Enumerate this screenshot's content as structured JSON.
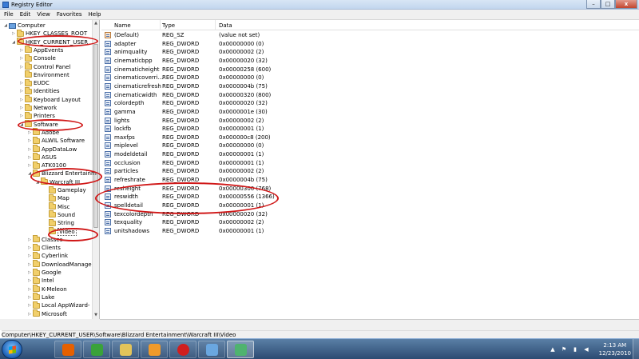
{
  "window": {
    "title": "Registry Editor",
    "btn_min": "–",
    "btn_max": "□",
    "btn_close": "x"
  },
  "menu": [
    "File",
    "Edit",
    "View",
    "Favorites",
    "Help"
  ],
  "tree": [
    {
      "label": "Computer",
      "indent": 0,
      "icon": "computer",
      "exp": "◢"
    },
    {
      "label": "HKEY_CLASSES_ROOT",
      "indent": 1,
      "icon": "folder",
      "exp": "▷"
    },
    {
      "label": "HKEY_CURRENT_USER",
      "indent": 1,
      "icon": "folder",
      "exp": "◢"
    },
    {
      "label": "AppEvents",
      "indent": 2,
      "icon": "folder",
      "exp": "▷"
    },
    {
      "label": "Console",
      "indent": 2,
      "icon": "folder",
      "exp": "▷"
    },
    {
      "label": "Control Panel",
      "indent": 2,
      "icon": "folder",
      "exp": "▷"
    },
    {
      "label": "Environment",
      "indent": 2,
      "icon": "folder",
      "exp": ""
    },
    {
      "label": "EUDC",
      "indent": 2,
      "icon": "folder",
      "exp": "▷"
    },
    {
      "label": "Identities",
      "indent": 2,
      "icon": "folder",
      "exp": "▷"
    },
    {
      "label": "Keyboard Layout",
      "indent": 2,
      "icon": "folder",
      "exp": "▷"
    },
    {
      "label": "Network",
      "indent": 2,
      "icon": "folder",
      "exp": "▷"
    },
    {
      "label": "Printers",
      "indent": 2,
      "icon": "folder",
      "exp": "▷"
    },
    {
      "label": "Software",
      "indent": 2,
      "icon": "folder",
      "exp": "◢"
    },
    {
      "label": "Adobe",
      "indent": 3,
      "icon": "folder",
      "exp": "▷"
    },
    {
      "label": "ALWIL Software",
      "indent": 3,
      "icon": "folder",
      "exp": "▷"
    },
    {
      "label": "AppDataLow",
      "indent": 3,
      "icon": "folder",
      "exp": "▷"
    },
    {
      "label": "ASUS",
      "indent": 3,
      "icon": "folder",
      "exp": "▷"
    },
    {
      "label": "ATK0100",
      "indent": 3,
      "icon": "folder",
      "exp": "▷"
    },
    {
      "label": "Blizzard Entertainm",
      "indent": 3,
      "icon": "folder",
      "exp": "◢"
    },
    {
      "label": "Warcraft III",
      "indent": 4,
      "icon": "folder",
      "exp": "◢"
    },
    {
      "label": "Gameplay",
      "indent": 5,
      "icon": "folder",
      "exp": ""
    },
    {
      "label": "Map",
      "indent": 5,
      "icon": "folder",
      "exp": ""
    },
    {
      "label": "Misc",
      "indent": 5,
      "icon": "folder",
      "exp": ""
    },
    {
      "label": "Sound",
      "indent": 5,
      "icon": "folder",
      "exp": ""
    },
    {
      "label": "String",
      "indent": 5,
      "icon": "folder",
      "exp": ""
    },
    {
      "label": "Video",
      "indent": 5,
      "icon": "folder",
      "exp": "",
      "selected": true
    },
    {
      "label": "Classes",
      "indent": 3,
      "icon": "folder",
      "exp": "▷"
    },
    {
      "label": "Clients",
      "indent": 3,
      "icon": "folder",
      "exp": "▷"
    },
    {
      "label": "Cyberlink",
      "indent": 3,
      "icon": "folder",
      "exp": "▷"
    },
    {
      "label": "DownloadManage",
      "indent": 3,
      "icon": "folder",
      "exp": "▷"
    },
    {
      "label": "Google",
      "indent": 3,
      "icon": "folder",
      "exp": "▷"
    },
    {
      "label": "Intel",
      "indent": 3,
      "icon": "folder",
      "exp": "▷"
    },
    {
      "label": "K-Meleon",
      "indent": 3,
      "icon": "folder",
      "exp": "▷"
    },
    {
      "label": "Lake",
      "indent": 3,
      "icon": "folder",
      "exp": "▷"
    },
    {
      "label": "Local AppWizard-",
      "indent": 3,
      "icon": "folder",
      "exp": "▷"
    },
    {
      "label": "Microsoft",
      "indent": 3,
      "icon": "folder",
      "exp": "▷"
    }
  ],
  "columns": {
    "name": "Name",
    "type": "Type",
    "data": "Data"
  },
  "values": [
    {
      "name": "(Default)",
      "type": "REG_SZ",
      "data": "(value not set)",
      "kind": "str"
    },
    {
      "name": "adapter",
      "type": "REG_DWORD",
      "data": "0x00000000 (0)",
      "kind": "dword"
    },
    {
      "name": "animquality",
      "type": "REG_DWORD",
      "data": "0x00000002 (2)",
      "kind": "dword"
    },
    {
      "name": "cinematicbpp",
      "type": "REG_DWORD",
      "data": "0x00000020 (32)",
      "kind": "dword"
    },
    {
      "name": "cinematicheight",
      "type": "REG_DWORD",
      "data": "0x00000258 (600)",
      "kind": "dword"
    },
    {
      "name": "cinematicoverri...",
      "type": "REG_DWORD",
      "data": "0x00000000 (0)",
      "kind": "dword"
    },
    {
      "name": "cinematicrefresh",
      "type": "REG_DWORD",
      "data": "0x0000004b (75)",
      "kind": "dword"
    },
    {
      "name": "cinematicwidth",
      "type": "REG_DWORD",
      "data": "0x00000320 (800)",
      "kind": "dword"
    },
    {
      "name": "colordepth",
      "type": "REG_DWORD",
      "data": "0x00000020 (32)",
      "kind": "dword"
    },
    {
      "name": "gamma",
      "type": "REG_DWORD",
      "data": "0x0000001e (30)",
      "kind": "dword"
    },
    {
      "name": "lights",
      "type": "REG_DWORD",
      "data": "0x00000002 (2)",
      "kind": "dword"
    },
    {
      "name": "lockfb",
      "type": "REG_DWORD",
      "data": "0x00000001 (1)",
      "kind": "dword"
    },
    {
      "name": "maxfps",
      "type": "REG_DWORD",
      "data": "0x000000c8 (200)",
      "kind": "dword"
    },
    {
      "name": "miplevel",
      "type": "REG_DWORD",
      "data": "0x00000000 (0)",
      "kind": "dword"
    },
    {
      "name": "modeldetail",
      "type": "REG_DWORD",
      "data": "0x00000001 (1)",
      "kind": "dword"
    },
    {
      "name": "occlusion",
      "type": "REG_DWORD",
      "data": "0x00000001 (1)",
      "kind": "dword"
    },
    {
      "name": "particles",
      "type": "REG_DWORD",
      "data": "0x00000002 (2)",
      "kind": "dword"
    },
    {
      "name": "refreshrate",
      "type": "REG_DWORD",
      "data": "0x0000004b (75)",
      "kind": "dword"
    },
    {
      "name": "resheight",
      "type": "REG_DWORD",
      "data": "0x00000300 (768)",
      "kind": "dword"
    },
    {
      "name": "reswidth",
      "type": "REG_DWORD",
      "data": "0x00000556 (1366)",
      "kind": "dword"
    },
    {
      "name": "spelldetail",
      "type": "REG_DWORD",
      "data": "0x00000001 (1)",
      "kind": "dword"
    },
    {
      "name": "texcolordepth",
      "type": "REG_DWORD",
      "data": "0x00000020 (32)",
      "kind": "dword"
    },
    {
      "name": "texquality",
      "type": "REG_DWORD",
      "data": "0x00000002 (2)",
      "kind": "dword"
    },
    {
      "name": "unitshadows",
      "type": "REG_DWORD",
      "data": "0x00000001 (1)",
      "kind": "dword"
    }
  ],
  "status": "Computer\\HKEY_CURRENT_USER\\Software\\Blizzard Entertainment\\Warcraft III\\Video",
  "taskbar": {
    "apps": [
      {
        "name": "firefox-icon",
        "color": "#e66000"
      },
      {
        "name": "frog-icon",
        "color": "#3aa23a"
      },
      {
        "name": "explorer-icon",
        "color": "#e3c45a"
      },
      {
        "name": "media-player-icon",
        "color": "#f09a2a"
      },
      {
        "name": "record-icon",
        "color": "#d11f1f"
      },
      {
        "name": "paint-icon",
        "color": "#6aa7e0"
      },
      {
        "name": "registry-icon",
        "color": "#4fb36f"
      }
    ],
    "time": "2:13 AM",
    "date": "12/23/2010"
  },
  "colors": {
    "annotation": "#d01818",
    "taskbar": "#2c4b72"
  }
}
